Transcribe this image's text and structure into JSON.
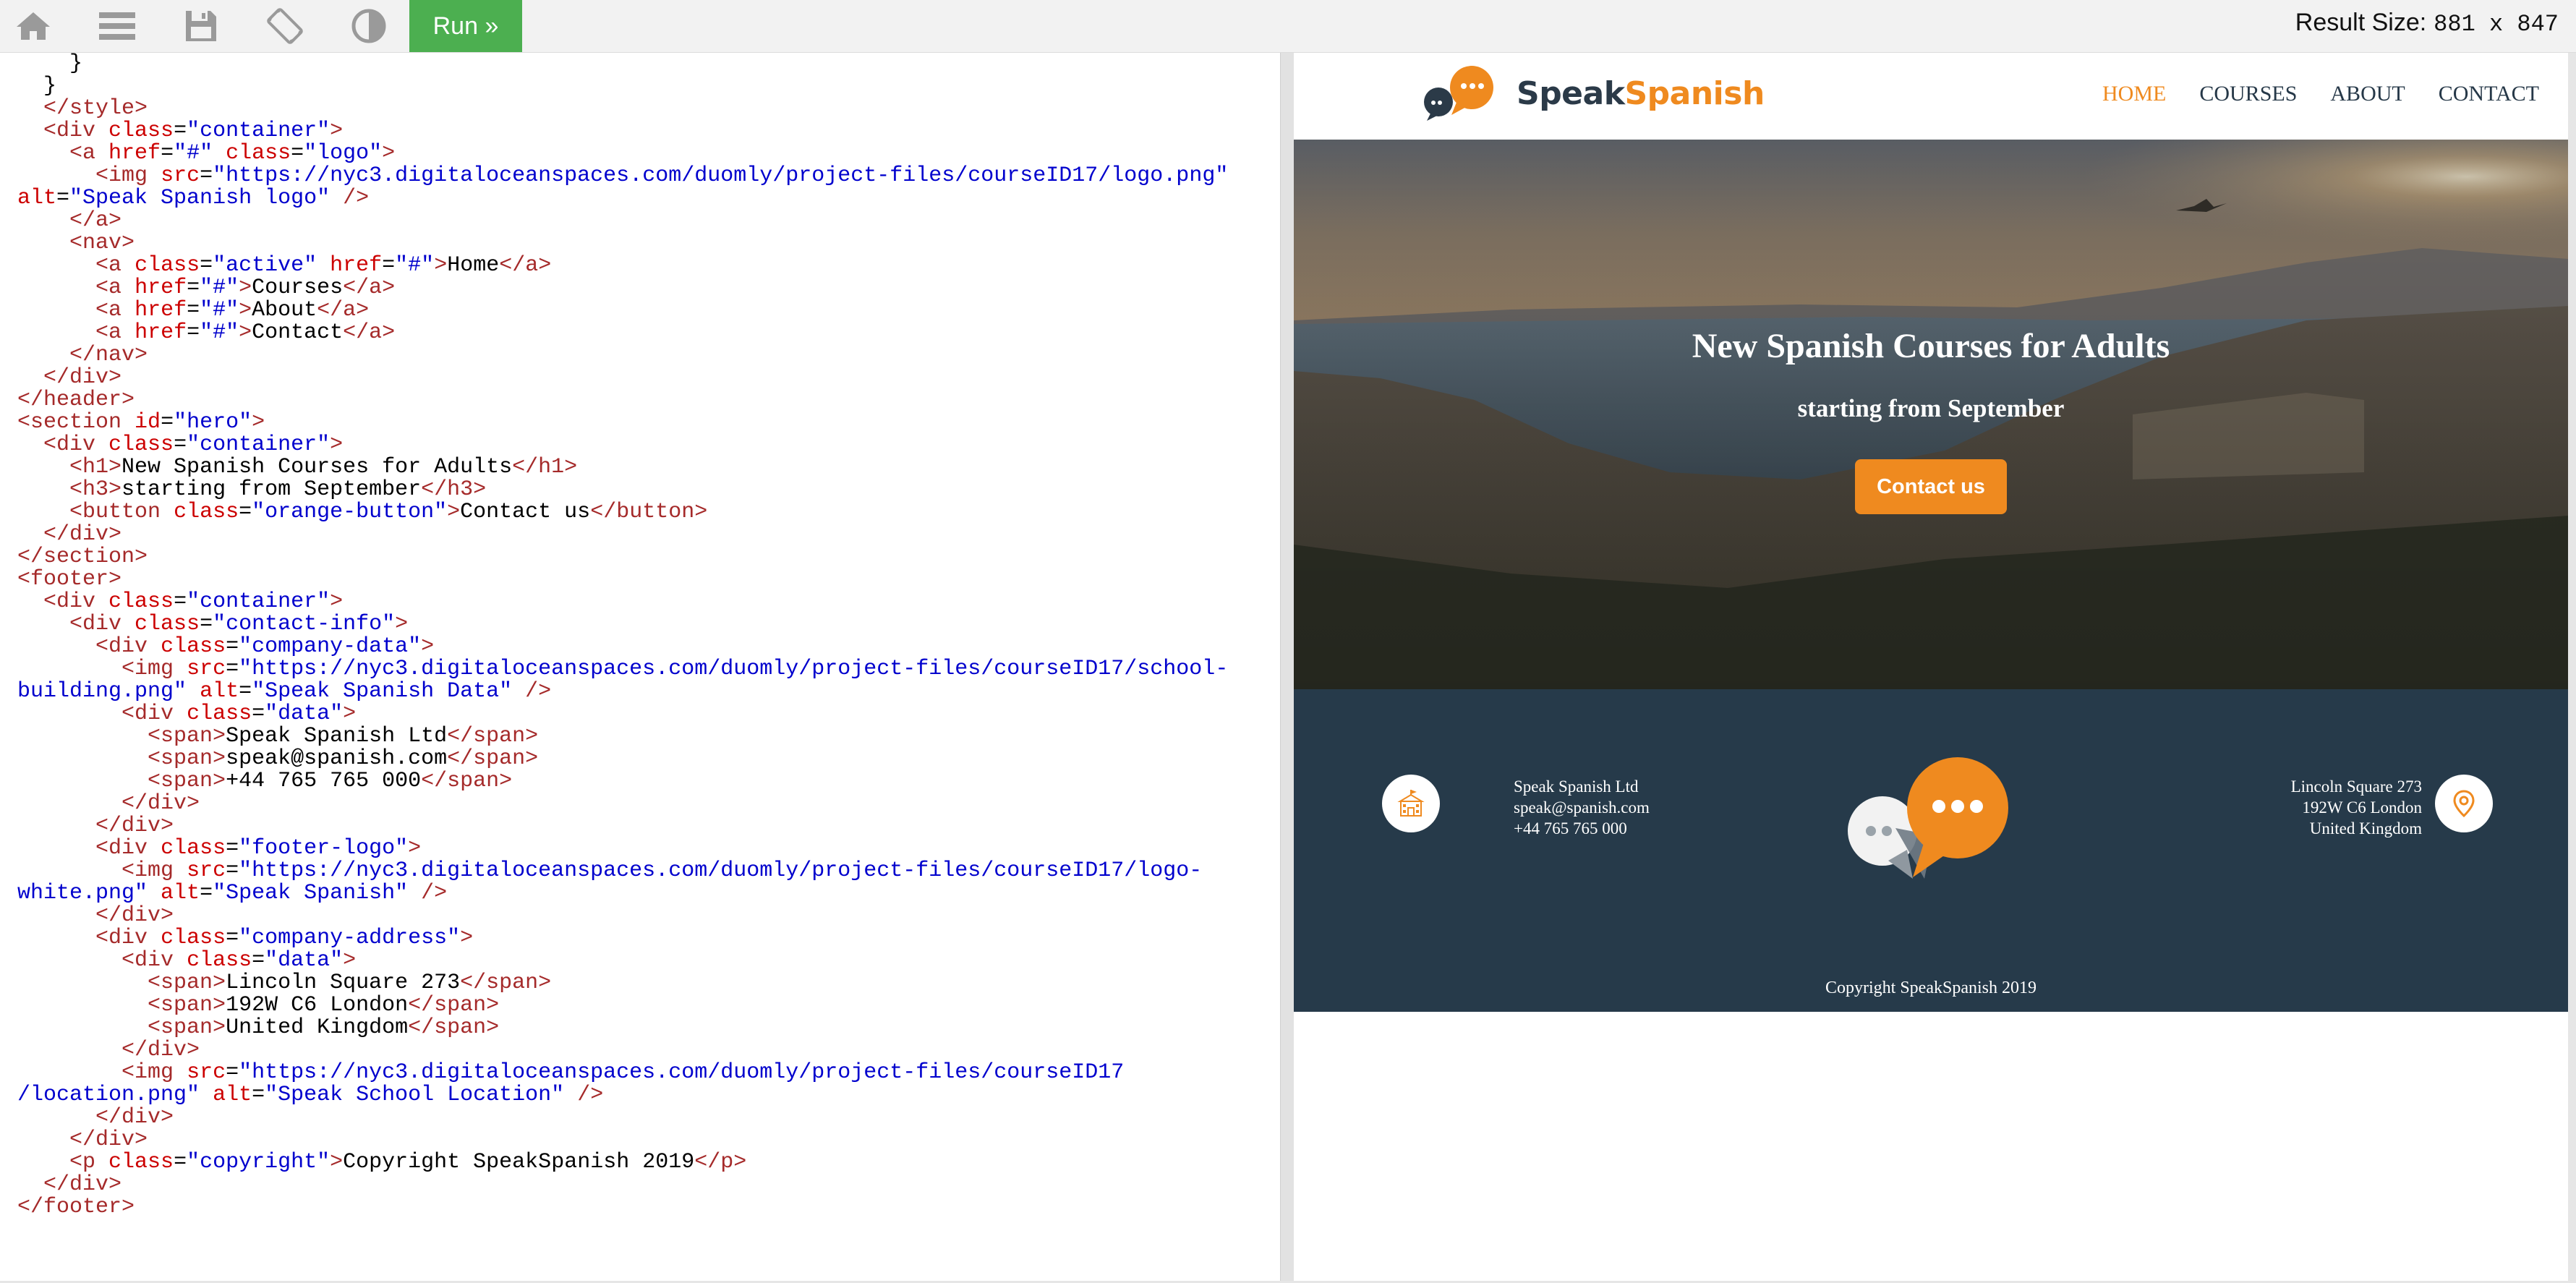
{
  "toolbar": {
    "icons": [
      "home-icon",
      "menu-icon",
      "save-icon",
      "rotate-icon",
      "contrast-icon"
    ],
    "run_label": "Run »",
    "result_size_label": "Result Size:",
    "result_size_value": "881 x 847",
    "run_color": "#4caf50"
  },
  "code": {
    "lines": [
      "    }",
      "  }",
      "  </style>",
      "  <div class=\"container\">",
      "    <a href=\"#\" class=\"logo\">",
      "      <img src=\"https://nyc3.digitaloceanspaces.com/duomly/project-files/courseID17/logo.png\"",
      "alt=\"Speak Spanish logo\" />",
      "    </a>",
      "    <nav>",
      "      <a class=\"active\" href=\"#\">Home</a>",
      "      <a href=\"#\">Courses</a>",
      "      <a href=\"#\">About</a>",
      "      <a href=\"#\">Contact</a>",
      "    </nav>",
      "  </div>",
      "</header>",
      "<section id=\"hero\">",
      "  <div class=\"container\">",
      "    <h1>New Spanish Courses for Adults</h1>",
      "    <h3>starting from September</h3>",
      "    <button class=\"orange-button\">Contact us</button>",
      "  </div>",
      "</section>",
      "<footer>",
      "  <div class=\"container\">",
      "    <div class=\"contact-info\">",
      "      <div class=\"company-data\">",
      "        <img src=\"https://nyc3.digitaloceanspaces.com/duomly/project-files/courseID17/school-",
      "building.png\" alt=\"Speak Spanish Data\" />",
      "        <div class=\"data\">",
      "          <span>Speak Spanish Ltd</span>",
      "          <span>speak@spanish.com</span>",
      "          <span>+44 765 765 000</span>",
      "        </div>",
      "      </div>",
      "      <div class=\"footer-logo\">",
      "        <img src=\"https://nyc3.digitaloceanspaces.com/duomly/project-files/courseID17/logo-",
      "white.png\" alt=\"Speak Spanish\" />",
      "      </div>",
      "      <div class=\"company-address\">",
      "        <div class=\"data\">",
      "          <span>Lincoln Square 273</span>",
      "          <span>192W C6 London</span>",
      "          <span>United Kingdom</span>",
      "        </div>",
      "        <img src=\"https://nyc3.digitaloceanspaces.com/duomly/project-files/courseID17",
      "/location.png\" alt=\"Speak School Location\" />",
      "      </div>",
      "    </div>",
      "    <p class=\"copyright\">Copyright SpeakSpanish 2019</p>",
      "  </div>",
      "</footer>"
    ]
  },
  "site": {
    "brand_speak": "Speak",
    "brand_spanish": "Spanish",
    "nav": [
      {
        "label": "HOME",
        "active": true
      },
      {
        "label": "COURSES",
        "active": false
      },
      {
        "label": "ABOUT",
        "active": false
      },
      {
        "label": "CONTACT",
        "active": false
      }
    ],
    "hero": {
      "title": "New Spanish Courses for Adults",
      "subtitle": "starting from September",
      "button_label": "Contact us"
    },
    "footer": {
      "company_data": [
        "Speak Spanish Ltd",
        "speak@spanish.com",
        "+44 765 765 000"
      ],
      "company_address": [
        "Lincoln Square 273",
        "192W C6 London",
        "United Kingdom"
      ],
      "copyright": "Copyright SpeakSpanish 2019"
    },
    "colors": {
      "accent": "#ef8a1f",
      "dark": "#263a4a",
      "nav_text": "#263848"
    }
  }
}
